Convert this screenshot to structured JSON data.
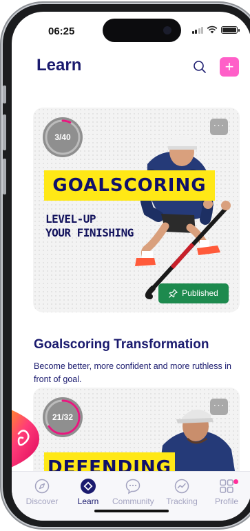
{
  "status": {
    "time": "06:25"
  },
  "header": {
    "title": "Learn"
  },
  "courses": [
    {
      "progress_label": "3/40",
      "progress": 0.075,
      "banner": "GOALSCORING",
      "tagline": [
        "LEVEL-UP",
        "YOUR FINISHING"
      ],
      "status_badge": "Published",
      "title": "Goalscoring Transformation",
      "description": "Become better, more confident and more ruthless in front of goal."
    },
    {
      "progress_label": "21/32",
      "progress": 0.656,
      "banner": "DEFENDING"
    }
  ],
  "bottom_nav": [
    {
      "label": "Discover",
      "icon": "compass-icon",
      "active": false
    },
    {
      "label": "Learn",
      "icon": "diamond-icon",
      "active": true
    },
    {
      "label": "Community",
      "icon": "chat-bubble-icon",
      "active": false
    },
    {
      "label": "Tracking",
      "icon": "chart-circle-icon",
      "active": false
    },
    {
      "label": "Profile",
      "icon": "grid-icon",
      "active": false,
      "notification": true
    }
  ],
  "colors": {
    "brand_navy": "#1a1a6e",
    "accent_pink": "#ff5fc8",
    "banner_yellow": "#ffe816",
    "published_green": "#1d8a4e",
    "progress_ring": "#e8177f"
  }
}
